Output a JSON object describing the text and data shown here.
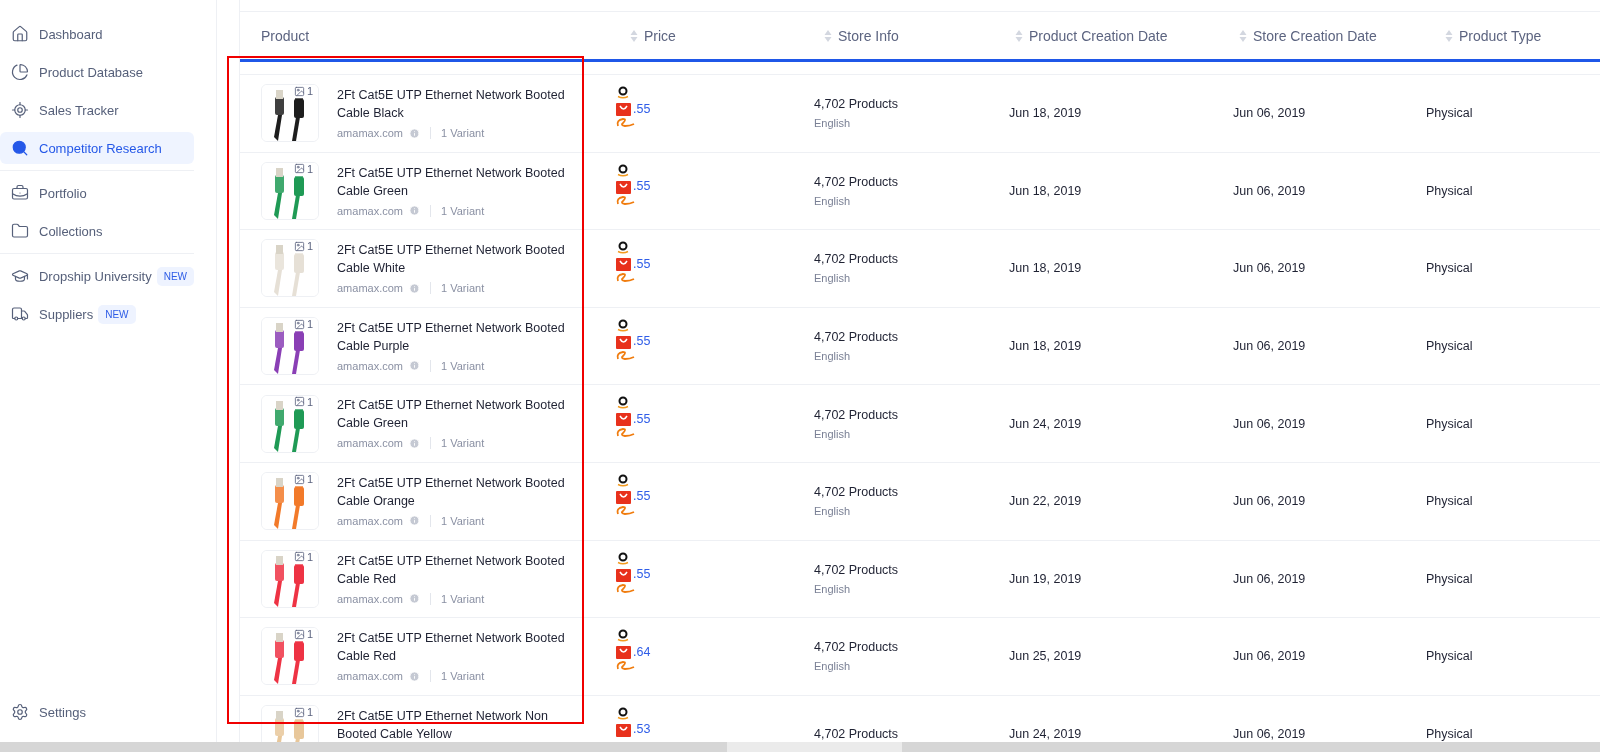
{
  "sidebar": {
    "groups": [
      {
        "items": [
          {
            "label": "Dashboard",
            "selected": false
          },
          {
            "label": "Product Database",
            "selected": false
          },
          {
            "label": "Sales Tracker",
            "selected": false
          },
          {
            "label": "Competitor Research",
            "selected": true
          }
        ]
      },
      {
        "items": [
          {
            "label": "Portfolio",
            "selected": false
          },
          {
            "label": "Collections",
            "selected": false
          }
        ]
      },
      {
        "items": [
          {
            "label": "Dropship University",
            "selected": false,
            "badge": "NEW"
          },
          {
            "label": "Suppliers",
            "selected": false,
            "badge": "NEW"
          }
        ]
      }
    ],
    "footer": {
      "label": "Settings",
      "selected": false
    }
  },
  "table": {
    "columns": [
      "Product",
      "Price",
      "Store Info",
      "Product Creation Date",
      "Store Creation Date",
      "Product Type"
    ],
    "rows": [
      {
        "image_count": "1",
        "title": "2Ft Cat5E UTP Ethernet Network Booted Cable Black",
        "store": "amamax.com",
        "variants": "1 Variant",
        "price": ".55",
        "products": "4,702 Products",
        "language": "English",
        "created": "Jun 18, 2019",
        "store_created": "Jun 06, 2019",
        "type": "Physical"
      },
      {
        "image_count": "1",
        "title": "2Ft Cat5E UTP Ethernet Network Booted Cable Green",
        "store": "amamax.com",
        "variants": "1 Variant",
        "price": ".55",
        "products": "4,702 Products",
        "language": "English",
        "created": "Jun 18, 2019",
        "store_created": "Jun 06, 2019",
        "type": "Physical"
      },
      {
        "image_count": "1",
        "title": "2Ft Cat5E UTP Ethernet Network Booted Cable White",
        "store": "amamax.com",
        "variants": "1 Variant",
        "price": ".55",
        "products": "4,702 Products",
        "language": "English",
        "created": "Jun 18, 2019",
        "store_created": "Jun 06, 2019",
        "type": "Physical"
      },
      {
        "image_count": "1",
        "title": "2Ft Cat5E UTP Ethernet Network Booted Cable Purple",
        "store": "amamax.com",
        "variants": "1 Variant",
        "price": ".55",
        "products": "4,702 Products",
        "language": "English",
        "created": "Jun 18, 2019",
        "store_created": "Jun 06, 2019",
        "type": "Physical"
      },
      {
        "image_count": "1",
        "title": "2Ft Cat5E UTP Ethernet Network Booted Cable Green",
        "store": "amamax.com",
        "variants": "1 Variant",
        "price": ".55",
        "products": "4,702 Products",
        "language": "English",
        "created": "Jun 24, 2019",
        "store_created": "Jun 06, 2019",
        "type": "Physical"
      },
      {
        "image_count": "1",
        "title": "2Ft Cat5E UTP Ethernet Network Booted Cable Orange",
        "store": "amamax.com",
        "variants": "1 Variant",
        "price": ".55",
        "products": "4,702 Products",
        "language": "English",
        "created": "Jun 22, 2019",
        "store_created": "Jun 06, 2019",
        "type": "Physical"
      },
      {
        "image_count": "1",
        "title": "2Ft Cat5E UTP Ethernet Network Booted Cable Red",
        "store": "amamax.com",
        "variants": "1 Variant",
        "price": ".55",
        "products": "4,702 Products",
        "language": "English",
        "created": "Jun 19, 2019",
        "store_created": "Jun 06, 2019",
        "type": "Physical"
      },
      {
        "image_count": "1",
        "title": "2Ft Cat5E UTP Ethernet Network Booted Cable Red",
        "store": "amamax.com",
        "variants": "1 Variant",
        "price": ".64",
        "products": "4,702 Products",
        "language": "English",
        "created": "Jun 25, 2019",
        "store_created": "Jun 06, 2019",
        "type": "Physical"
      },
      {
        "image_count": "1",
        "title": "2Ft Cat5E UTP Ethernet Network Non Booted Cable Yellow",
        "price": ".53",
        "products": "4,702 Products",
        "created": "Jun 24, 2019",
        "store_created": "Jun 06, 2019",
        "type": "Physical"
      }
    ]
  }
}
